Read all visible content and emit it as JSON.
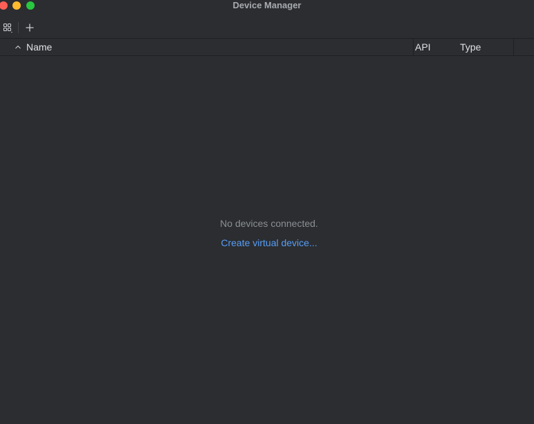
{
  "window": {
    "title": "Device Manager"
  },
  "table": {
    "columns": [
      "Name",
      "API",
      "Type"
    ],
    "sort": "ascending"
  },
  "empty_state": {
    "message": "No devices connected.",
    "link": "Create virtual device..."
  },
  "colors": {
    "background": "#2b2d30",
    "link": "#589df6",
    "muted_text": "#8c8f94"
  }
}
